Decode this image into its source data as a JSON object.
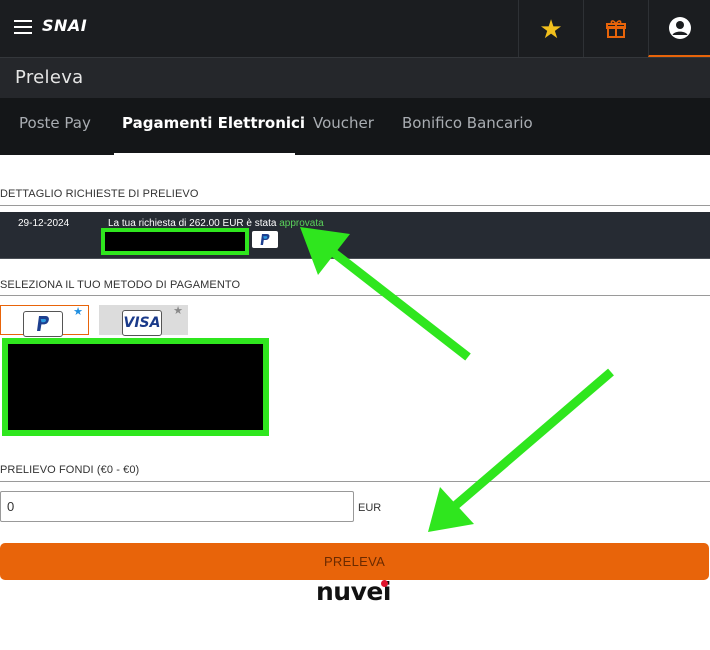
{
  "colors": {
    "accent": "#e8640a",
    "annotation_green": "#2fe61e",
    "status_green": "#5ad15a",
    "topbar": "#1b1d20"
  },
  "header": {
    "logo": "SNAI",
    "icons": [
      "menu-icon",
      "star-icon",
      "gift-icon",
      "user-account-icon"
    ]
  },
  "page": {
    "title": "Preleva"
  },
  "tabs": [
    {
      "label": "Poste Pay",
      "active": false
    },
    {
      "label": "Pagamenti Elettronici",
      "active": true
    },
    {
      "label": "Voucher",
      "active": false
    },
    {
      "label": "Bonifico Bancario",
      "active": false
    }
  ],
  "requests": {
    "heading": "DETTAGLIO RICHIESTE DI PRELIEVO",
    "rows": [
      {
        "date": "29-12-2024",
        "text": "La tua richiesta di 262.00 EUR è stata ",
        "status": "approvata",
        "method": "PayPal"
      }
    ]
  },
  "methods": {
    "heading": "SELEZIONA IL TUO METODO DI PAGAMENTO",
    "items": [
      {
        "name": "PayPal",
        "icon": "paypal-logo",
        "selected": true
      },
      {
        "name": "VISA",
        "icon": "visa-logo",
        "selected": false
      }
    ]
  },
  "withdraw": {
    "label": "PRELIEVO FONDI (€0 - €0)",
    "value": "0",
    "currency": "EUR",
    "button": "PRELEVA"
  },
  "footer": {
    "brand": "nuvei"
  }
}
